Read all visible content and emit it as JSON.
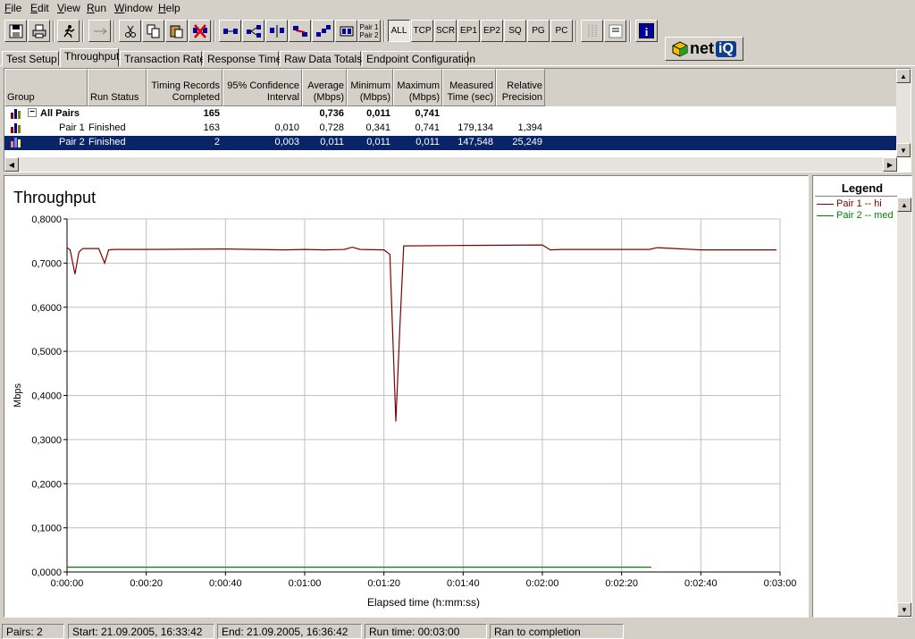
{
  "menu": [
    "File",
    "Edit",
    "View",
    "Run",
    "Window",
    "Help"
  ],
  "toolbar": {
    "pair_label_1": "Pair 1",
    "pair_label_2": "Pair 2",
    "filters": [
      "ALL",
      "TCP",
      "SCR",
      "EP1",
      "EP2",
      "SQ",
      "PG",
      "PC"
    ],
    "info_label": "i",
    "logo": {
      "text": "net",
      "badge": "iQ"
    }
  },
  "tabs": [
    "Test Setup",
    "Throughput",
    "Transaction Rate",
    "Response Time",
    "Raw Data Totals",
    "Endpoint Configuration"
  ],
  "active_tab": 1,
  "grid": {
    "headers": [
      "Group",
      "Run Status",
      "Timing Records\nCompleted",
      "95% Confidence\nInterval",
      "Average\n(Mbps)",
      "Minimum\n(Mbps)",
      "Maximum\n(Mbps)",
      "Measured\nTime (sec)",
      "Relative\nPrecision"
    ],
    "rows": [
      {
        "group": "All Pairs",
        "status": "",
        "records": "165",
        "ci": "",
        "avg": "0,736",
        "min": "0,011",
        "max": "0,741",
        "time": "",
        "precision": ""
      },
      {
        "group": "Pair 1",
        "status": "Finished",
        "records": "163",
        "ci": "0,010",
        "avg": "0,728",
        "min": "0,341",
        "max": "0,741",
        "time": "179,134",
        "precision": "1,394"
      },
      {
        "group": "Pair 2",
        "status": "Finished",
        "records": "2",
        "ci": "0,003",
        "avg": "0,011",
        "min": "0,011",
        "max": "0,011",
        "time": "147,548",
        "precision": "25,249"
      }
    ],
    "collapse_symbol": "−"
  },
  "chart_data": {
    "type": "line",
    "title": "Throughput",
    "xlabel": "Elapsed time (h:mm:ss)",
    "ylabel": "Mbps",
    "xlim": [
      0,
      180
    ],
    "ylim": [
      0,
      0.8
    ],
    "x_ticks": [
      0,
      20,
      40,
      60,
      80,
      100,
      120,
      140,
      160,
      180
    ],
    "x_tick_labels": [
      "0:00:00",
      "0:00:20",
      "0:00:40",
      "0:01:00",
      "0:01:20",
      "0:01:40",
      "0:02:00",
      "0:02:20",
      "0:02:40",
      "0:03:00"
    ],
    "y_ticks": [
      0,
      0.1,
      0.2,
      0.3,
      0.4,
      0.5,
      0.6,
      0.7,
      0.8
    ],
    "y_tick_labels": [
      "0,0000",
      "0,1000",
      "0,2000",
      "0,3000",
      "0,4000",
      "0,5000",
      "0,6000",
      "0,7000",
      "0,8000"
    ],
    "grid": true,
    "series": [
      {
        "name": "Pair 1 -- hi",
        "color": "#800000",
        "x": [
          0,
          0.8,
          2,
          3,
          4,
          6,
          8,
          9.5,
          10.5,
          12,
          20,
          40,
          55,
          60,
          65,
          70,
          72,
          74,
          80,
          81.5,
          83,
          84,
          85,
          86,
          100,
          120,
          122,
          125,
          140,
          147,
          149,
          160,
          179.1
        ],
        "y": [
          0.735,
          0.73,
          0.675,
          0.725,
          0.733,
          0.733,
          0.733,
          0.7,
          0.73,
          0.731,
          0.731,
          0.732,
          0.73,
          0.731,
          0.73,
          0.731,
          0.736,
          0.731,
          0.73,
          0.72,
          0.341,
          0.55,
          0.739,
          0.739,
          0.74,
          0.741,
          0.73,
          0.731,
          0.731,
          0.731,
          0.735,
          0.73,
          0.73
        ]
      },
      {
        "name": "Pair 2 -- med",
        "color": "#008000",
        "x": [
          0,
          147.5
        ],
        "y": [
          0.011,
          0.011
        ]
      }
    ],
    "legend_title": "Legend",
    "legend_position": "right"
  },
  "status": {
    "pairs": "Pairs: 2",
    "start": "Start: 21.09.2005, 16:33:42",
    "end": "End: 21.09.2005, 16:36:42",
    "runtime": "Run time: 00:03:00",
    "state": "Ran to completion"
  }
}
